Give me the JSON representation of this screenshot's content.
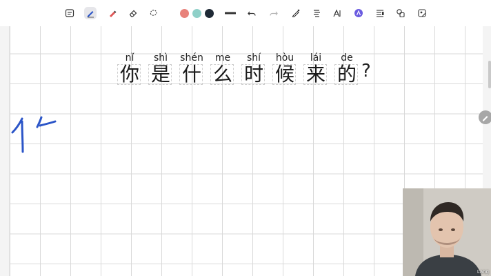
{
  "toolbar": {
    "tools": [
      {
        "name": "note-icon"
      },
      {
        "name": "pen-icon",
        "active": true
      },
      {
        "name": "highlighter-icon"
      },
      {
        "name": "eraser-icon"
      },
      {
        "name": "lasso-icon"
      },
      {
        "name": "stroke-width-icon"
      },
      {
        "name": "undo-icon"
      },
      {
        "name": "redo-icon"
      },
      {
        "name": "shape-pen-icon"
      },
      {
        "name": "text-tool-icon"
      },
      {
        "name": "text-format-icon"
      },
      {
        "name": "ai-icon"
      },
      {
        "name": "text-box-icon"
      },
      {
        "name": "shapes-icon"
      },
      {
        "name": "sticker-icon"
      }
    ],
    "colors": [
      "#e8827b",
      "#8fd0c8",
      "#1f2a36"
    ]
  },
  "sentence": {
    "pinyin": [
      "nǐ",
      "shì",
      "shén",
      "me",
      "shí",
      "hòu",
      "lái",
      "de"
    ],
    "hanzi": [
      "你",
      "是",
      "什",
      "么",
      "时",
      "候",
      "来",
      "的"
    ],
    "punct": "?"
  },
  "ink_color": "#2b55c8",
  "webcam": {
    "label": "Lang"
  }
}
